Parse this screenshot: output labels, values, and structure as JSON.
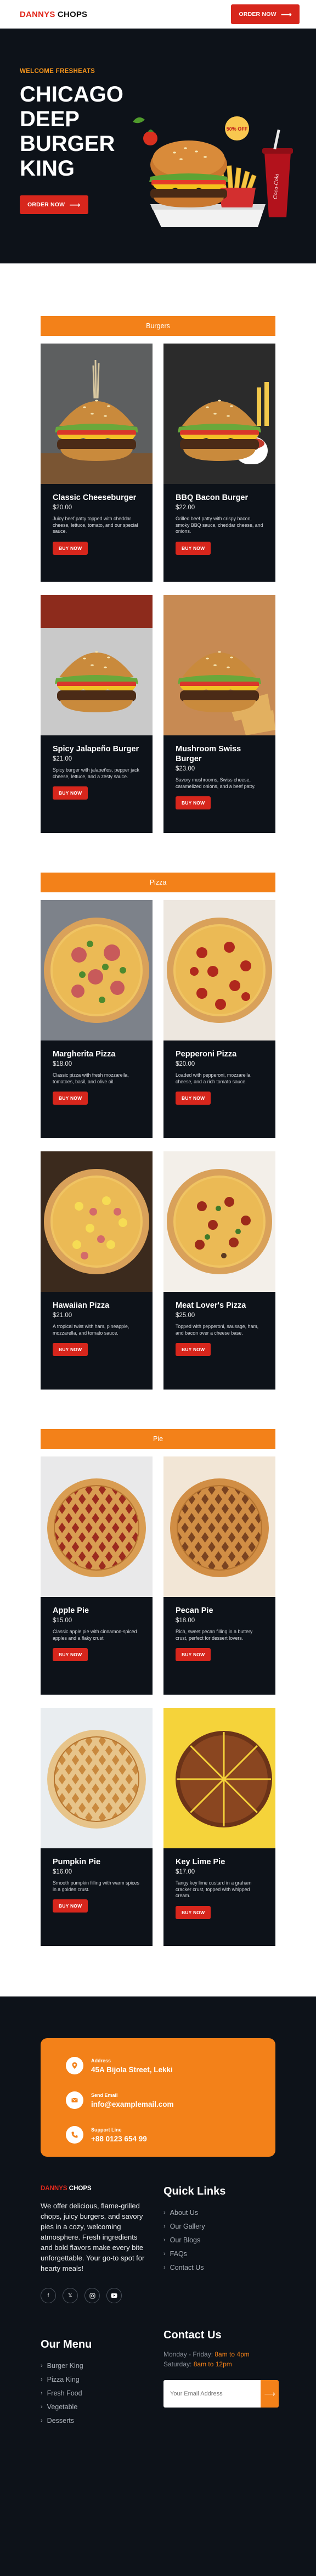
{
  "header": {
    "logo_part1": "DANNYS",
    "logo_part2": "CHOPS",
    "order_label": "ORDER NOW"
  },
  "hero": {
    "kicker": "WELCOME FRESHEATS",
    "title": "CHICAGO DEEP BURGER KING",
    "order_label": "ORDER NOW",
    "badge_text": "50% OFF",
    "can_text": "Coca-Cola"
  },
  "sections": [
    {
      "title": "Burgers",
      "items": [
        {
          "name": "Classic Cheeseburger",
          "price": "$20.00",
          "desc": "Juicy beef patty topped with cheddar cheese, lettuce, tomato, and our special sauce.",
          "button": "BUY NOW",
          "image": "burger-on-board"
        },
        {
          "name": "BBQ Bacon Burger",
          "price": "$22.00",
          "desc": "Grilled beef patty with crispy bacon, smoky BBQ sauce, cheddar cheese, and onions.",
          "button": "BUY NOW",
          "image": "burger-with-fries"
        },
        {
          "name": "Spicy Jalapeño Burger",
          "price": "$21.00",
          "desc": "Spicy burger with jalapeños, pepper jack cheese, lettuce, and a zesty sauce.",
          "button": "BUY NOW",
          "image": "burger-close-up"
        },
        {
          "name": "Mushroom Swiss Burger",
          "price": "$23.00",
          "desc": "Savory mushrooms, Swiss cheese, caramelized onions, and a beef patty.",
          "button": "BUY NOW",
          "image": "burger-with-wedges"
        }
      ]
    },
    {
      "title": "Pizza",
      "items": [
        {
          "name": "Margherita Pizza",
          "price": "$18.00",
          "desc": "Classic pizza with fresh mozzarella, tomatoes, basil, and olive oil.",
          "button": "BUY NOW",
          "image": "ham-arugula-pizza"
        },
        {
          "name": "Pepperoni Pizza",
          "price": "$20.00",
          "desc": "Loaded with pepperoni, mozzarella cheese, and a rich tomato sauce.",
          "button": "BUY NOW",
          "image": "pepperoni-pizza"
        },
        {
          "name": "Hawaiian Pizza",
          "price": "$21.00",
          "desc": "A tropical twist with ham, pineapple, mozzarella, and tomato sauce.",
          "button": "BUY NOW",
          "image": "hawaiian-pizza"
        },
        {
          "name": "Meat Lover's Pizza",
          "price": "$25.00",
          "desc": "Topped with pepperoni, sausage, ham, and bacon over a cheese base.",
          "button": "BUY NOW",
          "image": "meat-lovers-pizza"
        }
      ]
    },
    {
      "title": "Pie",
      "items": [
        {
          "name": "Apple Pie",
          "price": "$15.00",
          "desc": "Classic apple pie with cinnamon-spiced apples and a flaky crust.",
          "button": "BUY NOW",
          "image": "lattice-apple-pie"
        },
        {
          "name": "Pecan Pie",
          "price": "$18.00",
          "desc": "Rich, sweet pecan filling in a buttery crust, perfect for dessert lovers.",
          "button": "BUY NOW",
          "image": "lattice-pecan-pie"
        },
        {
          "name": "Pumpkin Pie",
          "price": "$16.00",
          "desc": "Smooth pumpkin filling with warm spices in a golden crust.",
          "button": "BUY NOW",
          "image": "lattice-pumpkin-pie"
        },
        {
          "name": "Key Lime Pie",
          "price": "$17.00",
          "desc": "Tangy key lime custard in a graham cracker crust, topped with whipped cream.",
          "button": "BUY NOW",
          "image": "sliced-pie-on-yellow"
        }
      ]
    }
  ],
  "contact": {
    "rows": [
      {
        "label": "Address",
        "value": "45A Bijola Street, Lekki",
        "icon": "location-icon"
      },
      {
        "label": "Send Email",
        "value": "info@examplemail.com",
        "icon": "email-icon"
      },
      {
        "label": "Support Line",
        "value": "+88 0123 654 99",
        "icon": "phone-icon"
      }
    ]
  },
  "footer": {
    "logo_part1": "DANNYS",
    "logo_part2": "CHOPS",
    "about": "We offer delicious, flame-grilled chops, juicy burgers, and savory pies in a cozy, welcoming atmosphere. Fresh ingredients and bold flavors make every bite unforgettable. Your go-to spot for hearty meals!",
    "socials": [
      "facebook-icon",
      "twitter-icon",
      "instagram-icon",
      "youtube-icon"
    ],
    "quick_links_title": "Quick Links",
    "quick_links": [
      "About Us",
      "Our Gallery",
      "Our Blogs",
      "FAQs",
      "Contact Us"
    ],
    "menu_title": "Our Menu",
    "menu_links": [
      "Burger King",
      "Pizza King",
      "Fresh Food",
      "Vegetable",
      "Desserts"
    ],
    "contact_title": "Contact Us",
    "hours": [
      {
        "day": "Monday - Friday:",
        "time": "8am to 4pm"
      },
      {
        "day": "Saturday:",
        "time": "8am to 12pm"
      }
    ],
    "email_placeholder": "Your Email Address"
  }
}
